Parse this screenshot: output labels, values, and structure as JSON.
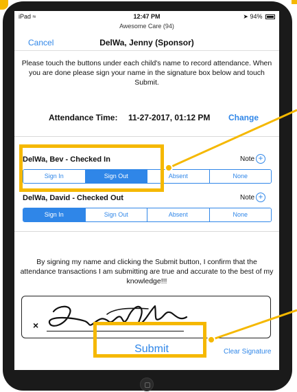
{
  "status_bar": {
    "carrier": "iPad",
    "wifi_icon": "wifi-icon",
    "time": "12:47 PM",
    "battery_text": "94%"
  },
  "app_title": "Awesome Care (94)",
  "nav": {
    "cancel_label": "Cancel",
    "title": "DelWa, Jenny (Sponsor)"
  },
  "instructions": "Please touch the buttons under each child's name to record attendance. When you are done please sign your name in the signature box below and touch Submit.",
  "attendance": {
    "label": "Attendance Time:",
    "value": "11-27-2017, 01:12 PM",
    "change_label": "Change"
  },
  "children": [
    {
      "name": "DelWa, Bev  - Checked In",
      "note_label": "Note",
      "buttons": [
        "Sign In",
        "Sign Out",
        "Absent",
        "None"
      ],
      "active_index": 1
    },
    {
      "name": "DelWa, David  - Checked Out",
      "note_label": "Note",
      "buttons": [
        "Sign In",
        "Sign Out",
        "Absent",
        "None"
      ],
      "active_index": 0
    }
  ],
  "confirmation": "By signing my name and clicking the Submit button, I confirm that the attendance transactions I am submitting are true and accurate to the best of my knowledge!!!",
  "signature": {
    "x_mark": "×"
  },
  "submit_label": "Submit",
  "clear_signature_label": "Clear Signature",
  "colors": {
    "accent": "#2f86e8",
    "highlight": "#f5b800",
    "device": "#1a1a1a"
  }
}
